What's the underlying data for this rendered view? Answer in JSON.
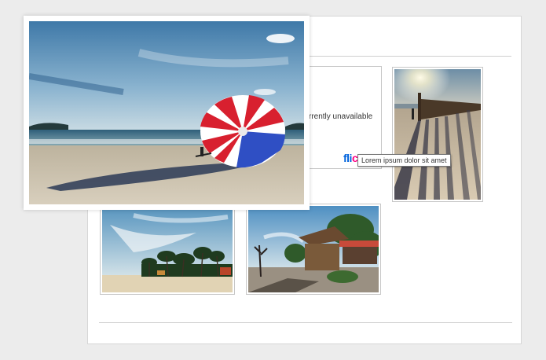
{
  "gallery": {
    "placeholder": {
      "message": "rrently unavailable",
      "logo_part1": "fli",
      "logo_part2": "ckr"
    },
    "tooltip": "Lorem ipsum dolor sit amet",
    "photos": [
      {
        "id": "parachute-beach",
        "icon": "parachute-beach-photo"
      },
      {
        "id": "pier-shadows",
        "icon": "pier-shadows-photo"
      },
      {
        "id": "palm-resort",
        "icon": "palm-resort-photo"
      },
      {
        "id": "beach-bar",
        "icon": "beach-bar-photo"
      }
    ]
  },
  "colors": {
    "flickr_blue": "#0063dc",
    "flickr_pink": "#ff0084",
    "parachute_red": "#d8202f",
    "parachute_blue": "#2f4fc4"
  }
}
